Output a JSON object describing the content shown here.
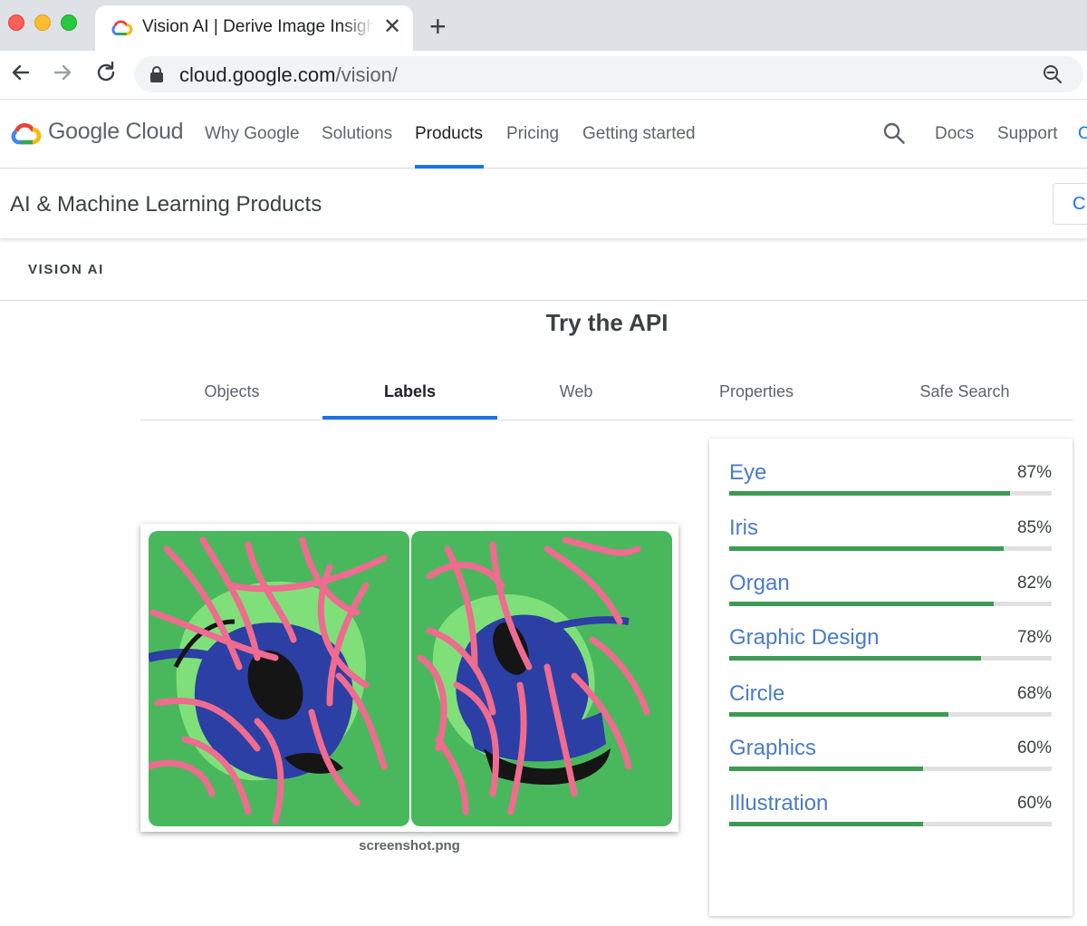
{
  "browser": {
    "tab_title": "Vision AI | Derive Image Insights via ML",
    "close_glyph": "✕",
    "new_tab_glyph": "+",
    "url_host": "cloud.google.com",
    "url_path": "/vision/"
  },
  "site": {
    "brand": "Google Cloud",
    "nav": [
      {
        "label": "Why Google"
      },
      {
        "label": "Solutions"
      },
      {
        "label": "Products",
        "active": true
      },
      {
        "label": "Pricing"
      },
      {
        "label": "Getting started"
      }
    ],
    "docs_label": "Docs",
    "support_label": "Support",
    "more_label": "C"
  },
  "subheader": {
    "title": "AI & Machine Learning Products",
    "button_label": "C"
  },
  "section": {
    "label": "VISION AI"
  },
  "demo": {
    "title": "Try the API",
    "tabs": [
      {
        "label": "Objects"
      },
      {
        "label": "Labels",
        "active": true
      },
      {
        "label": "Web"
      },
      {
        "label": "Properties"
      },
      {
        "label": "Safe Search"
      }
    ],
    "image_caption": "screenshot.png",
    "results": [
      {
        "label": "Eye",
        "percent": "87%",
        "value": 0.87
      },
      {
        "label": "Iris",
        "percent": "85%",
        "value": 0.85
      },
      {
        "label": "Organ",
        "percent": "82%",
        "value": 0.82
      },
      {
        "label": "Graphic Design",
        "percent": "78%",
        "value": 0.78
      },
      {
        "label": "Circle",
        "percent": "68%",
        "value": 0.68
      },
      {
        "label": "Graphics",
        "percent": "60%",
        "value": 0.6
      },
      {
        "label": "Illustration",
        "percent": "60%",
        "value": 0.6
      }
    ]
  },
  "colors": {
    "accent_blue": "#1a73e8",
    "label_blue": "#4a7cc4",
    "bar_green": "#3c9a54",
    "track_gray": "#e0e0e0"
  }
}
